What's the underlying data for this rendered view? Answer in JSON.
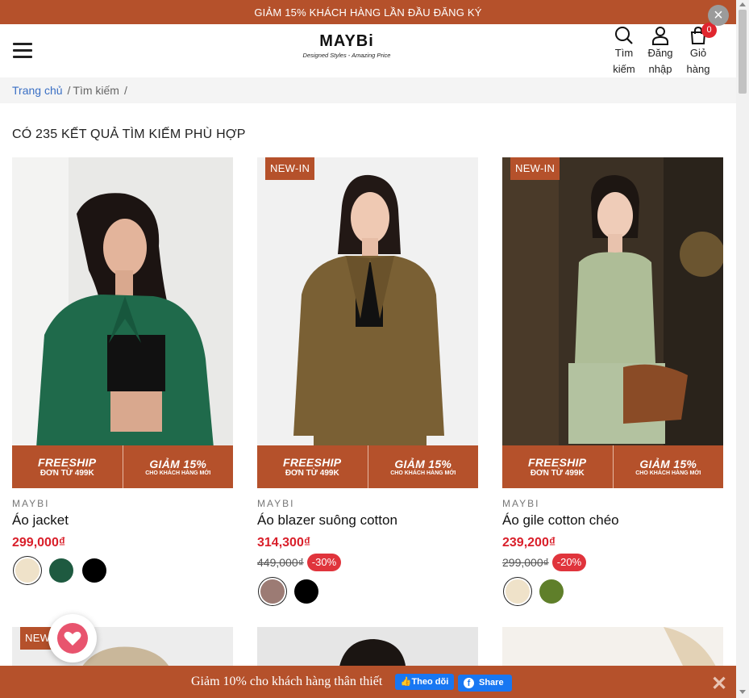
{
  "announcement": "GIẢM 15% KHÁCH HÀNG LẦN ĐẦU ĐĂNG KÝ",
  "header": {
    "logo": "MAYBi",
    "tagline": "Designed Styles - Amazing Price",
    "search_label_1": "Tìm",
    "search_label_2": "kiếm",
    "login_label_1": "Đăng",
    "login_label_2": "nhập",
    "cart_label_1": "Giỏ",
    "cart_label_2": "hàng",
    "cart_count": "0"
  },
  "breadcrumb": {
    "home": "Trang chủ",
    "current": "Tìm kiếm",
    "sep": "/"
  },
  "results_title": "CÓ 235 KẾT QUẢ TÌM KIẾM PHÙ HỢP",
  "promo": {
    "left_big": "FREESHIP",
    "left_small": "ĐƠN TỪ 499K",
    "right_big": "GIẢM 15%",
    "right_small": "CHO KHÁCH HÀNG MỚI"
  },
  "products": [
    {
      "brand": "MAYBI",
      "name": "Áo jacket",
      "price": "299,000₫",
      "badge": "",
      "colors": [
        "#efe2c9",
        "#1e5a40",
        "#000000"
      ]
    },
    {
      "brand": "MAYBI",
      "name": "Áo blazer suông cotton",
      "price": "314,300₫",
      "old_price": "449,000₫",
      "discount": "-30%",
      "badge": "NEW-IN",
      "colors": [
        "#9c7b74",
        "#000000"
      ]
    },
    {
      "brand": "MAYBI",
      "name": "Áo gile cotton chéo",
      "price": "239,200₫",
      "old_price": "299,000₫",
      "discount": "-20%",
      "badge": "NEW-IN",
      "colors": [
        "#efe2c9",
        "#5f7f2a"
      ]
    }
  ],
  "next_row_badge": "NEW",
  "bottom_bar": {
    "text": "Giảm 10% cho khách hàng thân thiết",
    "follow": "Theo dõi",
    "share": "Share"
  },
  "colors": {
    "accent": "#b5512b",
    "sale": "#d91f2a",
    "link": "#3a6fc4"
  }
}
